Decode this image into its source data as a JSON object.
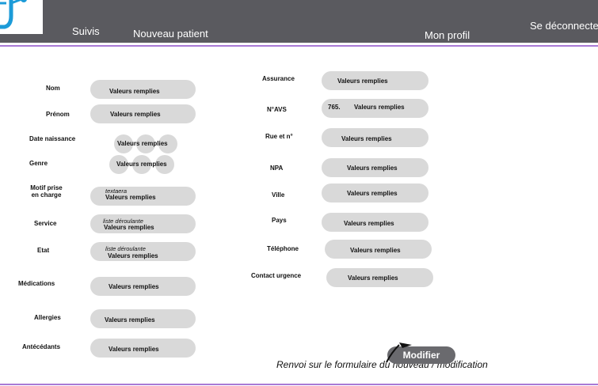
{
  "header": {
    "nav_followups": "Suivis",
    "nav_new_patient": "Nouveau patient",
    "nav_my_profile": "Mon profil",
    "nav_logout": "Se déconnecte"
  },
  "colors": {
    "topbar": "#5a5a5f",
    "accent_line": "#a97ad6",
    "pill": "#d9d9d9",
    "button": "#6a6a6e",
    "logo_blue": "#1c9bd8"
  },
  "left_fields": [
    {
      "label": "Nom",
      "value": "Valeurs remplies"
    },
    {
      "label": "Prénom",
      "value": "Valeurs remplies"
    },
    {
      "label": "Date naissance",
      "value": "Valeurs remplies"
    },
    {
      "label": "Genre",
      "value": "Valeurs remplies"
    },
    {
      "label": "Motif prise en charge",
      "hint": "textaera",
      "value": "Valeurs remplies"
    },
    {
      "label": "Service",
      "hint": "liste déroulante",
      "value": "Valeurs remplies"
    },
    {
      "label": "Etat",
      "hint": "liste déroulante",
      "value": "Valeurs remplies"
    },
    {
      "label": "Médications",
      "value": "Valeurs remplies"
    },
    {
      "label": "Allergies",
      "value": "Valeurs remplies"
    },
    {
      "label": "Antécédants",
      "value": "Valeurs remplies"
    }
  ],
  "right_fields": [
    {
      "label": "Assurance",
      "value": "Valeurs remplies"
    },
    {
      "label": "N°AVS",
      "prefix": "765.",
      "value": "Valeurs remplies"
    },
    {
      "label": "Rue et n°",
      "value": "Valeurs remplies"
    },
    {
      "label": "NPA",
      "value": "Valeurs remplies"
    },
    {
      "label": "Ville",
      "value": "Valeurs remplies"
    },
    {
      "label": "Pays",
      "value": "Valeurs remplies"
    },
    {
      "label": "Téléphone",
      "value": "Valeurs remplies"
    },
    {
      "label": "Contact urgence",
      "value": "Valeurs remplies"
    }
  ],
  "actions": {
    "modify_label": "Modifier",
    "note": "Renvoi sur le formulaire du nouveau / modification"
  }
}
